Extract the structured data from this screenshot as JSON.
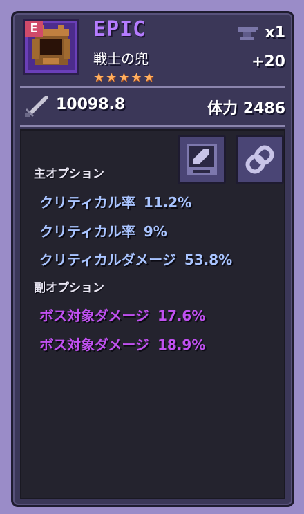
{
  "item": {
    "grade_badge": "E",
    "rarity": "EPIC",
    "name": "戦士の兜",
    "stars": 5,
    "star_glyph": "★",
    "quantity": "x1",
    "enhance": "+20",
    "icon": "helmet-icon"
  },
  "stats": {
    "attack_icon": "sword-icon",
    "attack": "10098.8",
    "hp_label": "体力",
    "hp_value": "2486"
  },
  "buttons": {
    "edit": "edit-icon",
    "link": "chain-link-icon"
  },
  "main_options": {
    "label": "主オプション",
    "items": [
      {
        "name": "クリティカル率",
        "value": "11.2%"
      },
      {
        "name": "クリティカル率",
        "value": "9%"
      },
      {
        "name": "クリティカルダメージ",
        "value": "53.8%"
      }
    ]
  },
  "sub_options": {
    "label": "副オプション",
    "items": [
      {
        "name": "ボス対象ダメージ",
        "value": "17.6%"
      },
      {
        "name": "ボス対象ダメージ",
        "value": "18.9%"
      }
    ]
  },
  "colors": {
    "rarity": "#b57cff",
    "main_option": "#a9c4ff",
    "sub_option": "#c050f0",
    "star": "#ffb060"
  }
}
